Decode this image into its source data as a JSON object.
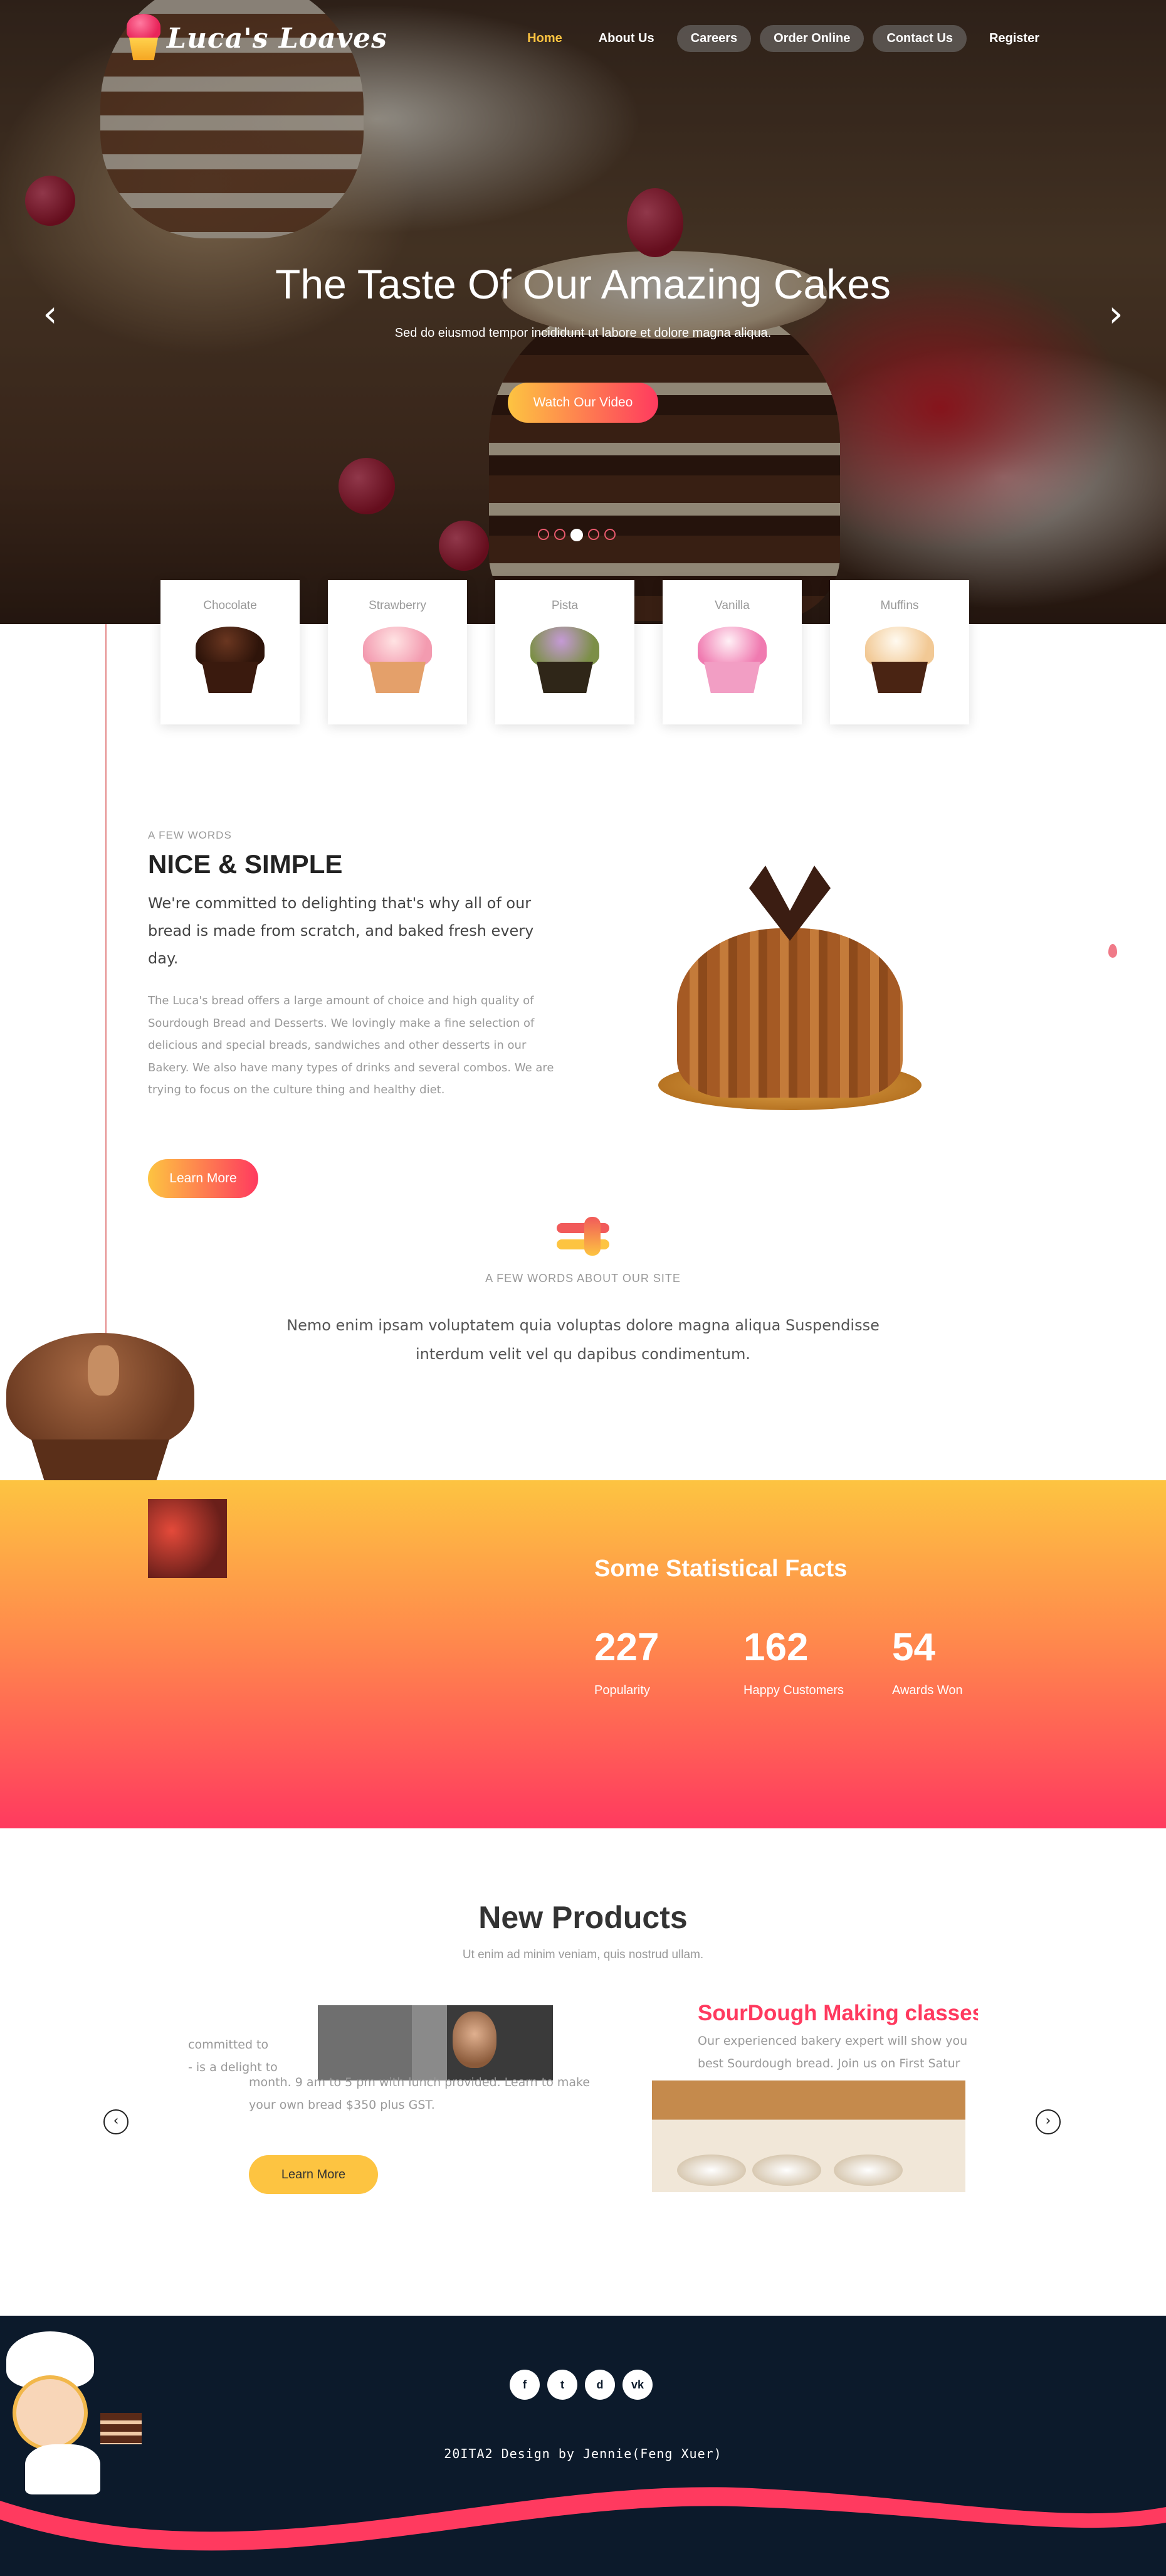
{
  "brand": {
    "name": "Luca's Loaves"
  },
  "nav": [
    {
      "label": "Home",
      "state": "active"
    },
    {
      "label": "About Us"
    },
    {
      "label": "Careers"
    },
    {
      "label": "Order Online"
    },
    {
      "label": "Contact Us"
    },
    {
      "label": "Register"
    }
  ],
  "hero": {
    "title": "The Taste Of Our Amazing Cakes",
    "subtitle": "Sed do eiusmod tempor incididunt ut labore et dolore magna aliqua.",
    "button": "Watch Our Video",
    "prev_icon": "chevron-left-icon",
    "next_icon": "chevron-right-icon",
    "slides_total": 5,
    "slide_active": 3
  },
  "categories": [
    {
      "name": "Chocolate"
    },
    {
      "name": "Strawberry"
    },
    {
      "name": "Pista"
    },
    {
      "name": "Vanilla"
    },
    {
      "name": "Muffins"
    }
  ],
  "about": {
    "eyebrow": "A FEW WORDS",
    "title": "NICE & SIMPLE",
    "lead": "We're committed to delighting that's why all of our bread is made from scratch, and baked fresh every day.",
    "body": "The Luca's bread offers a large amount of choice and high quality of Sourdough Bread and Desserts. We lovingly make a fine selection of delicious and special breads, sandwiches and other desserts in our Bakery. We also have many types of drinks and several combos. We are trying to focus on the culture thing and healthy diet.",
    "button": "Learn More"
  },
  "site": {
    "eyebrow": "A FEW WORDS ABOUT OUR SITE",
    "text": "Nemo enim ipsam voluptatem quia voluptas dolore magna aliqua Suspendisse interdum velit vel qu dapibus condimentum."
  },
  "stats": {
    "title": "Some Statistical Facts",
    "items": [
      {
        "value": "227",
        "label": "Popularity"
      },
      {
        "value": "162",
        "label": "Happy Customers"
      },
      {
        "value": "54",
        "label": "Awards Won"
      }
    ]
  },
  "products": {
    "title": "New Products",
    "subtitle": "Ut enim ad minim veniam, quis nostrud ullam.",
    "item1": {
      "text_a": "committed to\n- is a delight to",
      "text_b": "month. 9 am to 5 pm with lunch provided. Learn to make your own bread $350 plus GST.",
      "button": "Learn More"
    },
    "item2": {
      "title": "SourDough Making classes",
      "text": "Our experienced bakery expert will show you\nbest Sourdough bread. Join us on First Satur"
    }
  },
  "footer": {
    "social": [
      "f",
      "t",
      "d",
      "vk"
    ],
    "social_icons": [
      "facebook-icon",
      "twitter-icon",
      "dribbble-icon",
      "vk-icon"
    ],
    "credit": "20ITA2 Design by Jennie(Feng Xuer)"
  },
  "colors": {
    "accent_yellow": "#fdc441",
    "accent_red": "#ff3a5f",
    "footer_bg": "#0c1a2b"
  }
}
